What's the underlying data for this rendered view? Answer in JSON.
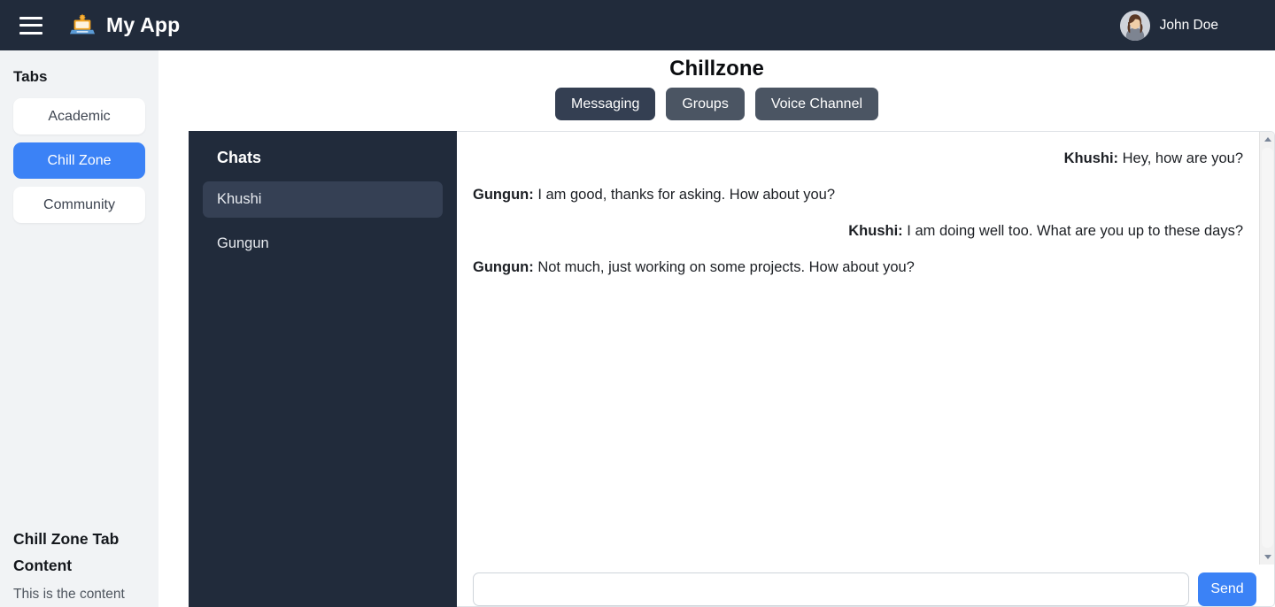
{
  "navbar": {
    "menu_icon": "hamburger-menu-icon",
    "logo_icon": "laptop-app-logo-icon",
    "title": "My App",
    "user": {
      "name": "John Doe",
      "avatar_icon": "user-avatar-icon"
    }
  },
  "sidebar": {
    "heading": "Tabs",
    "tabs": [
      {
        "label": "Academic",
        "active": false
      },
      {
        "label": "Chill Zone",
        "active": true
      },
      {
        "label": "Community",
        "active": false
      }
    ],
    "content": {
      "heading": "Chill Zone Tab Content",
      "text": "This is the content"
    }
  },
  "main": {
    "title": "Chillzone",
    "channel_tabs": [
      {
        "label": "Messaging",
        "active": true
      },
      {
        "label": "Groups",
        "active": false
      },
      {
        "label": "Voice Channel",
        "active": false
      }
    ]
  },
  "chats": {
    "title": "Chats",
    "items": [
      {
        "label": "Khushi",
        "active": true
      },
      {
        "label": "Gungun",
        "active": false
      }
    ]
  },
  "conversation": {
    "messages": [
      {
        "sender": "Khushi:",
        "text": "Hey, how are you?",
        "side": "out"
      },
      {
        "sender": "Gungun:",
        "text": "I am good, thanks for asking. How about you?",
        "side": "in"
      },
      {
        "sender": "Khushi:",
        "text": "I am doing well too. What are you up to these days?",
        "side": "out"
      },
      {
        "sender": "Gungun:",
        "text": "Not much, just working on some projects. How about you?",
        "side": "in"
      }
    ]
  },
  "composer": {
    "input_value": "",
    "input_placeholder": "",
    "send_label": "Send"
  },
  "scrollbar": {
    "up_icon": "chevron-up-icon",
    "down_icon": "chevron-down-icon"
  },
  "colors": {
    "navbar_bg": "#212b3b",
    "panel_bg": "#212b3b",
    "accent_blue": "#3b82f6",
    "tab_active": "#343f52",
    "tab_inactive": "#4b5563",
    "sidebar_bg": "#f1f3f5"
  }
}
